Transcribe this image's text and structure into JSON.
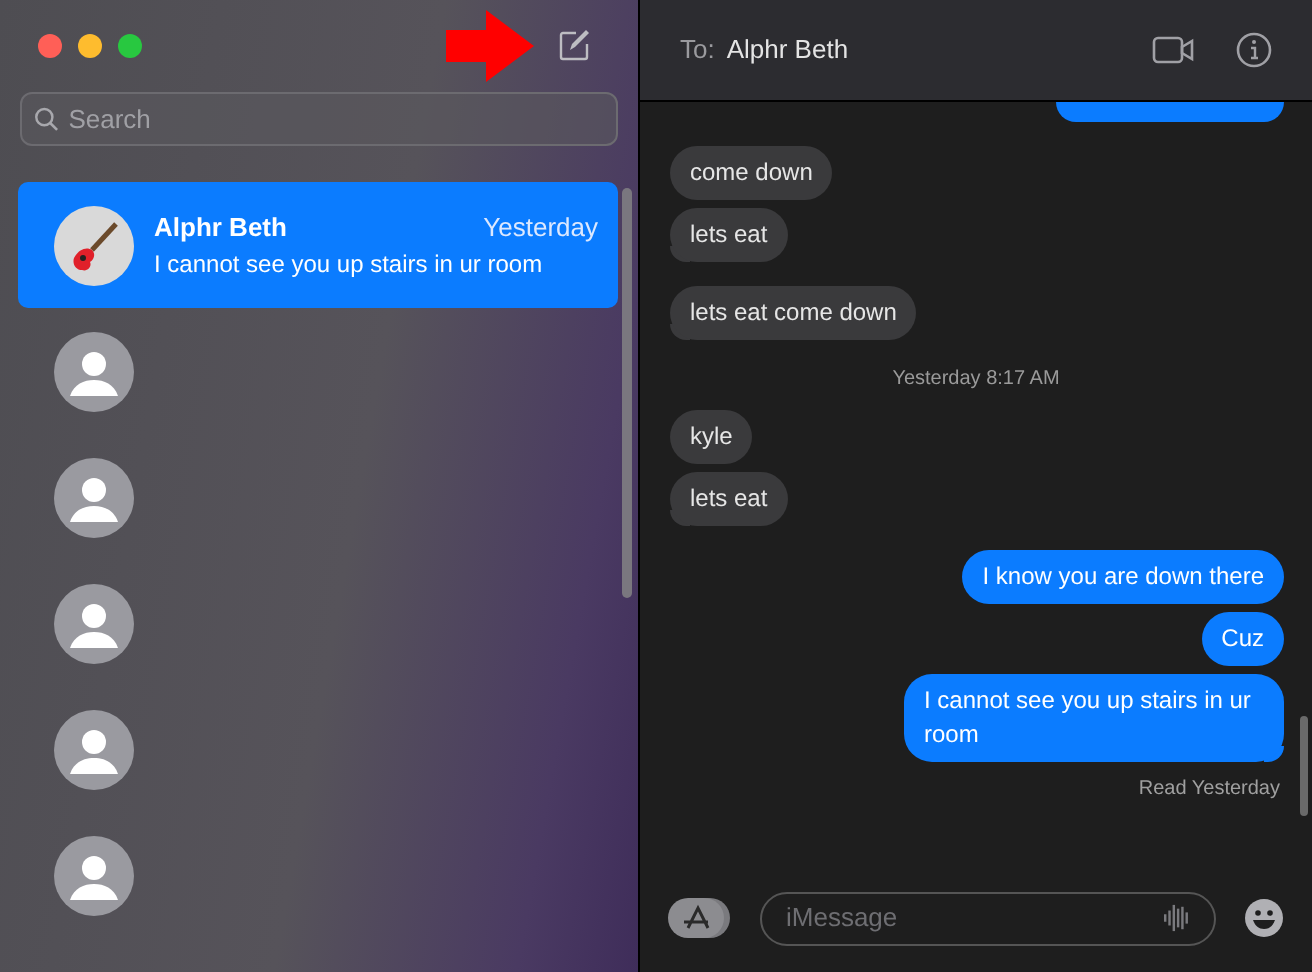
{
  "search": {
    "placeholder": "Search"
  },
  "conversations": [
    {
      "name": "Alphr Beth",
      "time": "Yesterday",
      "preview": "I cannot see you up stairs in ur room",
      "selected": true
    },
    {
      "selected": false
    },
    {
      "selected": false
    },
    {
      "selected": false
    },
    {
      "selected": false
    },
    {
      "selected": false
    }
  ],
  "header": {
    "to_label": "To:",
    "recipient": "Alphr Beth"
  },
  "messages": [
    {
      "kind": "outgoing_cut"
    },
    {
      "kind": "incoming",
      "text": "come down",
      "tail": false
    },
    {
      "kind": "incoming",
      "text": "lets eat",
      "tail": true
    },
    {
      "kind": "incoming",
      "text": "lets eat come down",
      "tail": true
    },
    {
      "kind": "timestamp",
      "text": "Yesterday 8:17 AM"
    },
    {
      "kind": "incoming",
      "text": "kyle",
      "tail": false
    },
    {
      "kind": "incoming",
      "text": "lets eat",
      "tail": true
    },
    {
      "kind": "outgoing",
      "text": "I know you are down there",
      "tail": false
    },
    {
      "kind": "outgoing",
      "text": "Cuz",
      "tail": false
    },
    {
      "kind": "outgoing",
      "text": "I cannot see you up stairs in ur room",
      "tail": true
    },
    {
      "kind": "read",
      "text": "Read Yesterday"
    }
  ],
  "composer": {
    "placeholder": "iMessage"
  }
}
